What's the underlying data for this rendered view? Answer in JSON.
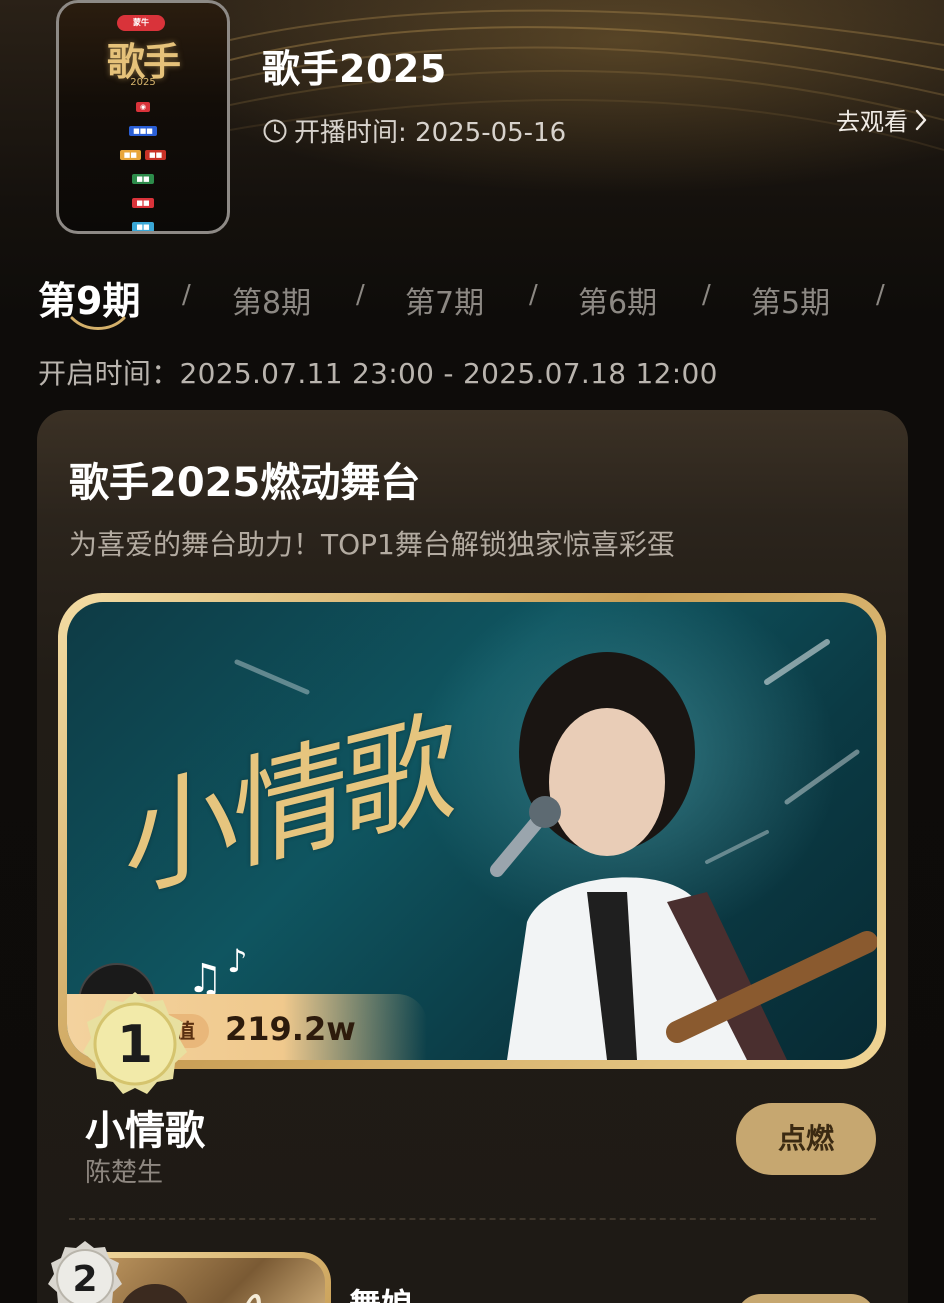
{
  "show": {
    "title": "歌手2025",
    "air_time": "开播时间: 2025-05-16",
    "watch_label": "去观看",
    "poster": {
      "logo_text": "歌手",
      "year_text": "2025",
      "badge_text": "蒙牛"
    }
  },
  "episodes": {
    "tabs": [
      "第9期",
      "第8期",
      "第7期",
      "第6期",
      "第5期"
    ],
    "active_index": 0,
    "separator": "/",
    "open_time": "开启时间：2025.07.11 23:00 - 2025.07.18 12:00"
  },
  "card": {
    "title": "歌手2025燃动舞台",
    "subtitle": "为喜爱的舞台助力！TOP1舞台解锁独家惊喜彩蛋"
  },
  "entries": [
    {
      "rank": "1",
      "stage_text": "小情歌",
      "heat_label": "燃力值",
      "heat_value": "219.2w",
      "song": "小情歌",
      "artist": "陈楚生",
      "button": "点燃"
    },
    {
      "rank": "2",
      "song": "舞娘"
    }
  ],
  "colors": {
    "accent_gold": "#c6a770",
    "frame_gold": "#c99f56",
    "background": "#0d0b09"
  }
}
